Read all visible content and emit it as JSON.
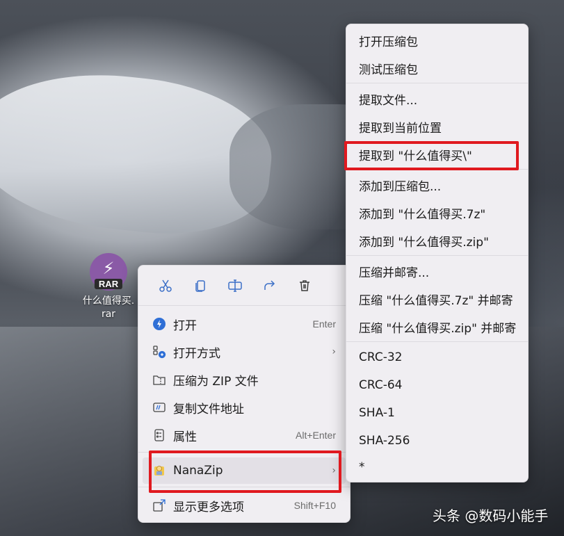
{
  "desktop": {
    "file_icon_badge": "RAR",
    "file_name_line1": "什么值得买.",
    "file_name_line2": "rar",
    "accent_icon_color": "#8a5aa6"
  },
  "context_menu": {
    "toolbar": [
      {
        "name": "cut-icon",
        "label": "✂"
      },
      {
        "name": "copy-icon",
        "label": "⧉"
      },
      {
        "name": "rename-icon",
        "label": "⌶"
      },
      {
        "name": "share-icon",
        "label": "↗"
      },
      {
        "name": "delete-icon",
        "label": "🗑"
      }
    ],
    "items": [
      {
        "label": "打开",
        "shortcut": "Enter",
        "icon": "open-icon"
      },
      {
        "label": "打开方式",
        "has_submenu": true,
        "icon": "open-with-icon"
      },
      {
        "label": "压缩为 ZIP 文件",
        "icon": "zip-folder-icon"
      },
      {
        "label": "复制文件地址",
        "icon": "copy-path-icon"
      },
      {
        "label": "属性",
        "shortcut": "Alt+Enter",
        "icon": "properties-icon"
      },
      {
        "label": "NanaZip",
        "has_submenu": true,
        "icon": "nanazip-icon",
        "highlighted": true
      },
      {
        "label": "显示更多选项",
        "shortcut": "Shift+F10",
        "icon": "more-options-icon"
      }
    ],
    "submenu_arrow": "›"
  },
  "nanazip_submenu": {
    "items": [
      "打开压缩包",
      "测试压缩包",
      "提取文件...",
      "提取到当前位置",
      "提取到 \"什么值得买\\\"",
      "添加到压缩包...",
      "添加到 \"什么值得买.7z\"",
      "添加到 \"什么值得买.zip\"",
      "压缩并邮寄...",
      "压缩 \"什么值得买.7z\" 并邮寄",
      "压缩 \"什么值得买.zip\" 并邮寄",
      "CRC-32",
      "CRC-64",
      "SHA-1",
      "SHA-256",
      "*"
    ]
  },
  "annotation_color": "#e0191f",
  "watermark": "头条 @数码小能手"
}
